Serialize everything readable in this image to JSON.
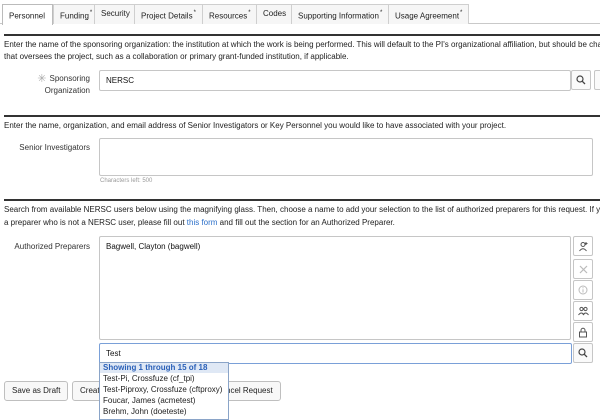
{
  "tabs": [
    {
      "label": "Personnel",
      "star": "",
      "active": true
    },
    {
      "label": "Funding",
      "star": "*"
    },
    {
      "label": "Security",
      "star": ""
    },
    {
      "label": "Project Details",
      "star": "*"
    },
    {
      "label": "Resources",
      "star": "*"
    },
    {
      "label": "Codes",
      "star": ""
    },
    {
      "label": "Supporting Information",
      "star": "*"
    },
    {
      "label": "Usage Agreement",
      "star": "*"
    }
  ],
  "sponsor": {
    "desc_line1": "Enter the name of the sponsoring organization: the institution at which the work is being performed. This will default to the PI's organizational affiliation, but should be cha",
    "desc_line2": "that oversees the project, such as a collaboration or primary grant-funded institution, if applicable.",
    "label_line1": "Sponsoring",
    "label_line2": "Organization",
    "required_mark": "✳",
    "value": "NERSC"
  },
  "senior": {
    "desc": "Enter the name, organization, and email address of Senior Investigators or Key Personnel you would like to have associated with your project.",
    "label": "Senior Investigators",
    "value": "",
    "chars_left": "Characters left: 500"
  },
  "preparers": {
    "desc_line1": "Search from available NERSC users below using the magnifying glass. Then, choose a name to add your selection to the list of authorized preparers for this request. If y",
    "desc_line2_a": "a preparer who is not a NERSC user, please fill out ",
    "desc_link": "this form",
    "desc_line2_b": " and fill out the section for an Authorized Preparer.",
    "label": "Authorized Preparers",
    "list": [
      "Bagwell, Clayton (bagwell)"
    ],
    "search_value": "Test"
  },
  "dropdown": {
    "header": "Showing 1 through 15 of 18",
    "items": [
      "Test-Pi, Crossfuze (cf_tpi)",
      "Test-Piproxy, Crossfuze (cftproxy)",
      "Foucar, James (acmetest)",
      "Brehm, John (doeteste)"
    ]
  },
  "buttons": {
    "save_draft": "Save as Draft",
    "create_partial": "Create",
    "cancel_partial": "ncel Request"
  },
  "colors": {
    "link": "#2b6fc9",
    "dropdown_header": "#2a60b8",
    "section_rule": "#333333"
  }
}
